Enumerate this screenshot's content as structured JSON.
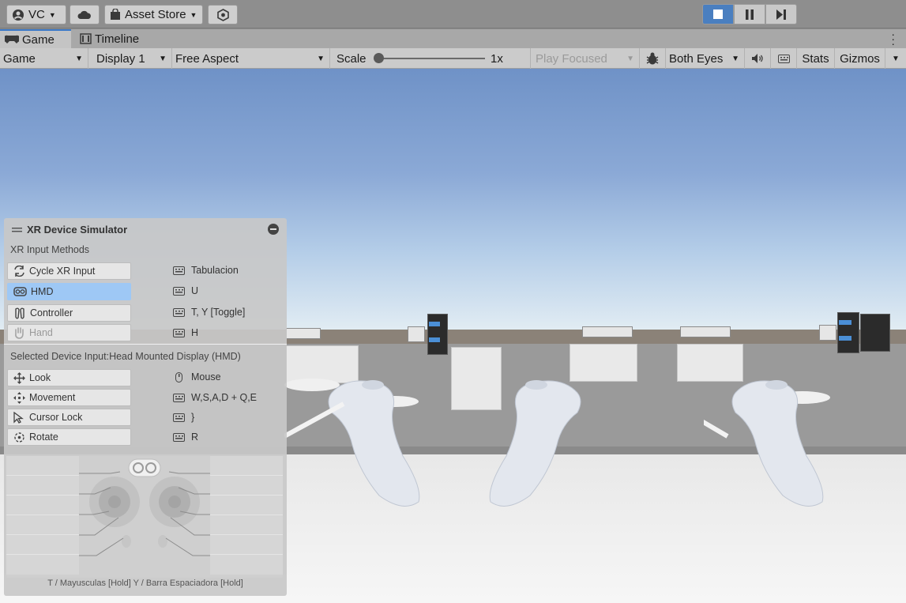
{
  "toolbar": {
    "account_label": "VC",
    "store_label": "Asset Store",
    "play_controls": [
      "stop",
      "pause",
      "step"
    ]
  },
  "tabs": [
    {
      "label": "Game",
      "active": true
    },
    {
      "label": "Timeline",
      "active": false
    }
  ],
  "game_toolbar": {
    "mode": "Game",
    "display": "Display 1",
    "aspect": "Free Aspect",
    "scale_label": "Scale",
    "scale_value": "1x",
    "scale_level": 0,
    "play_focused": "Play Focused",
    "eyes": "Both Eyes",
    "stats": "Stats",
    "gizmos": "Gizmos"
  },
  "simulator": {
    "title": "XR Device Simulator",
    "section_methods": "XR Input Methods",
    "methods": [
      {
        "label": "Cycle XR Input",
        "key": "Tabulacion",
        "icon": "cycle-icon",
        "state": "normal"
      },
      {
        "label": "HMD",
        "key": "U",
        "icon": "hmd-icon",
        "state": "selected"
      },
      {
        "label": "Controller",
        "key": "T, Y [Toggle]",
        "icon": "controller-icon",
        "state": "normal"
      },
      {
        "label": "Hand",
        "key": "H",
        "icon": "hand-icon",
        "state": "disabled"
      }
    ],
    "section_device": "Selected Device Input:Head Mounted Display (HMD)",
    "device_inputs": [
      {
        "label": "Look",
        "key": "Mouse",
        "icon": "look-icon",
        "key_icon": "mouse"
      },
      {
        "label": "Movement",
        "key": "W,S,A,D + Q,E",
        "icon": "move-icon",
        "key_icon": "keyboard"
      },
      {
        "label": "Cursor Lock",
        "key": "}",
        "icon": "cursor-icon",
        "key_icon": "keyboard"
      },
      {
        "label": "Rotate",
        "key": "R",
        "icon": "rotate-icon",
        "key_icon": "keyboard"
      }
    ],
    "footer": "T / Mayusculas [Hold]  Y / Barra Espaciadora [Hold]"
  },
  "colors": {
    "play_active": "#4a7fc0",
    "selected_row": "#9ec8f5"
  }
}
